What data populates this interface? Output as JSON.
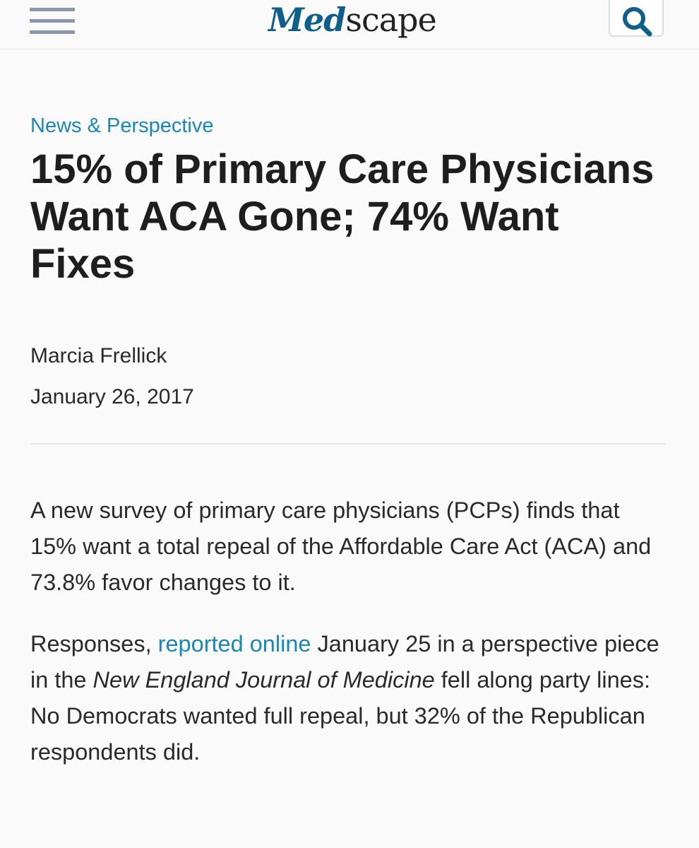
{
  "header": {
    "menu_icon": "hamburger-menu-icon",
    "logo_part1": "Med",
    "logo_part2": "scape",
    "search_icon": "search-icon"
  },
  "article": {
    "kicker": "News & Perspective",
    "headline": "15% of Primary Care Physicians Want ACA Gone; 74% Want Fixes",
    "author": "Marcia Frellick",
    "date": "January 26, 2017",
    "para1": "A new survey of primary care physicians (PCPs) finds that 15% want a total repeal of the Affordable Care Act (ACA) and 73.8% favor changes to it.",
    "para2": {
      "text_before_link": "Responses, ",
      "link_text": "reported online",
      "text_after_link": " January 25 in a perspective piece in the ",
      "journal": "New England Journal of Medicine",
      "text_end": " fell along party lines: No Democrats wanted full repeal, but 32% of the Republican respondents did."
    }
  },
  "colors": {
    "accent_blue": "#1a87b5",
    "logo_blue": "#0f5f8a",
    "menu_gray": "#8a97ad"
  }
}
